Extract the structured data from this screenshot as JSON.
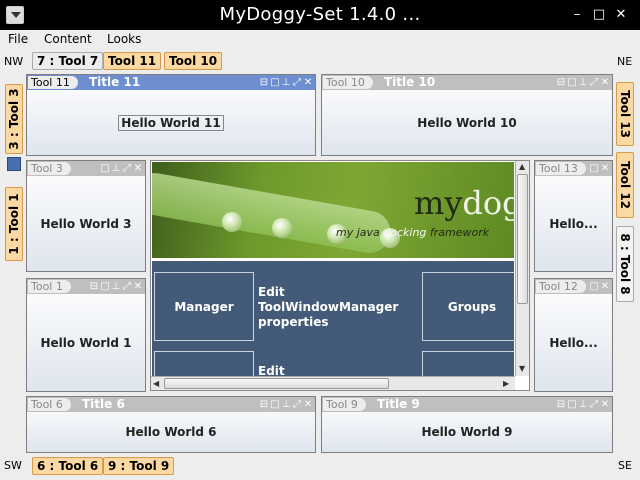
{
  "window": {
    "title": "MyDoggy-Set 1.4.0 ...",
    "minimize_icon": "minimize-icon",
    "maximize_icon": "maximize-icon",
    "close_icon": "close-icon"
  },
  "menu": {
    "items": [
      "File",
      "Content",
      "Looks"
    ]
  },
  "corners": {
    "nw": "NW",
    "ne": "NE",
    "sw": "SW",
    "se": "SE"
  },
  "bars": {
    "top": [
      "7 : Tool 7",
      "Tool 11",
      "Tool 10"
    ],
    "bottom": [
      "6 : Tool 6",
      "9 : Tool 9"
    ],
    "left": [
      "3 : Tool 3",
      "1 : Tool 1"
    ],
    "right": [
      "Tool 13",
      "Tool 12",
      "8 : Tool 8"
    ]
  },
  "toolwindows": {
    "tool11": {
      "tab": "Tool 11",
      "title": "Title 11",
      "body": "Hello World 11"
    },
    "tool10": {
      "tab": "Tool 10",
      "title": "Title 10",
      "body": "Hello World 10"
    },
    "tool3": {
      "tab": "Tool 3",
      "title": "",
      "body": "Hello World 3"
    },
    "tool1": {
      "tab": "Tool 1",
      "title": "",
      "body": "Hello World 1"
    },
    "tool13": {
      "tab": "Tool 13",
      "title": "",
      "body": "Hello..."
    },
    "tool12": {
      "tab": "Tool 12",
      "title": "",
      "body": "Hello..."
    },
    "tool6": {
      "tab": "Tool 6",
      "title": "Title 6",
      "body": "Hello World 6"
    },
    "tool9": {
      "tab": "Tool 9",
      "title": "Title 9",
      "body": "Hello World 9"
    }
  },
  "content": {
    "brand_prefix": "my",
    "brand_suffix": "dogg",
    "tagline_prefix": "my java ",
    "tagline_highlight": "docking",
    "tagline_suffix": " framework",
    "cells": {
      "manager": "Manager",
      "edit_desc": "Edit ToolWindowManager properties",
      "groups": "Groups",
      "edit2": "Edit"
    }
  },
  "colors": {
    "accent_orange": "#fcd9a2",
    "active_header": "#6d8fd1",
    "panel_blue": "#435a78"
  }
}
